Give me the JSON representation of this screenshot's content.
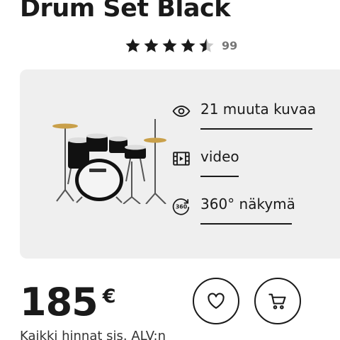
{
  "product": {
    "title": "Drum Set Black",
    "rating_value": 4.5,
    "rating_max": 5,
    "rating_count": "99"
  },
  "media": {
    "links": [
      {
        "label": "21 muuta kuvaa",
        "icon": "eye-icon"
      },
      {
        "label": "video",
        "icon": "film-icon"
      },
      {
        "label": "360° näkymä",
        "icon": "rotate-360-icon"
      }
    ]
  },
  "pricing": {
    "price": "185",
    "currency": "€",
    "tax_note": "Kaikki hinnat sis. ALV:n"
  },
  "actions": {
    "wishlist_icon": "heart-icon",
    "cart_icon": "cart-icon"
  },
  "colors": {
    "text": "#1a1a1a",
    "panel_bg": "#efefef",
    "star_filled": "#1a1a1a",
    "star_empty": "#c8c8c8",
    "muted": "#777777"
  }
}
